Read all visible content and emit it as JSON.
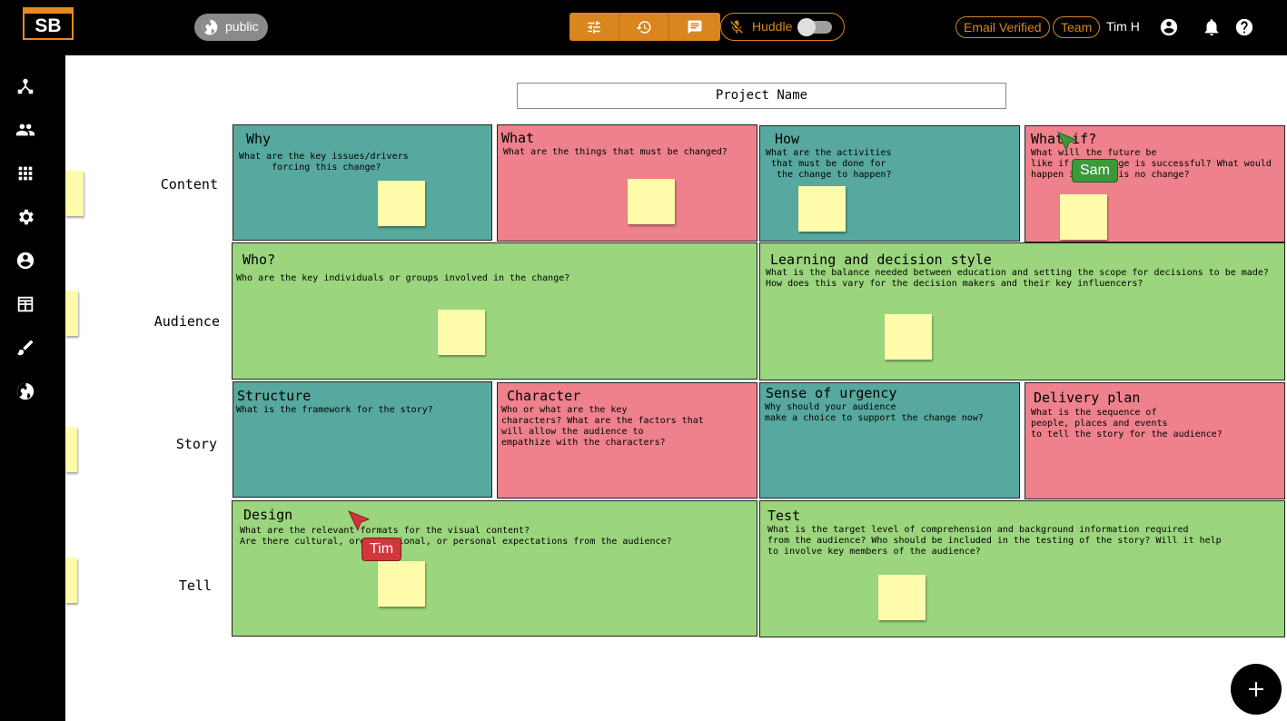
{
  "topbar": {
    "logo_text": "SB",
    "visibility_label": "public",
    "huddle_label": "Huddle",
    "email_verified_label": "Email Verified",
    "team_label": "Team",
    "user_name": "Tim H",
    "accent_color": "#d9861f"
  },
  "board": {
    "project_name": "Project Name",
    "rows": [
      "Content",
      "Audience",
      "Story",
      "Tell"
    ],
    "cells": {
      "why": {
        "title": "Why",
        "desc": "What are the key issues/drivers\n      forcing this change?"
      },
      "what": {
        "title": "What",
        "desc": "What are the things that must be changed?"
      },
      "how": {
        "title": "How",
        "desc": "What are the activities\n that must be done for\n  the change to happen?"
      },
      "what_if": {
        "title": "What if?",
        "desc": "What will the future be\nlike if the change is successful? What would\nhappen if there is no change?"
      },
      "who": {
        "title": "Who?",
        "desc": "Who are the key individuals or groups involved in the change?"
      },
      "learning": {
        "title": "Learning and decision style",
        "desc": "What is the balance needed between education and setting the scope for decisions to be made?\nHow does this vary for the decision makers and their key influencers?"
      },
      "structure": {
        "title": "Structure",
        "desc": "What is the framework for the story?"
      },
      "character": {
        "title": "Character",
        "desc": "Who or what are the key\ncharacters? What are the factors that\nwill allow the audience to\nempathize with the characters?"
      },
      "urgency": {
        "title": "Sense of urgency",
        "desc": "Why should your audience\nmake a choice to support the change now?"
      },
      "delivery": {
        "title": "Delivery plan",
        "desc": "What is the sequence of\npeople, places and events\nto tell the story for the audience?"
      },
      "design": {
        "title": "Design",
        "desc": "What are the relevant formats for the visual content?\nAre there cultural, organizational, or personal expectations from the audience?"
      },
      "test": {
        "title": "Test",
        "desc": "What is the target level of comprehension and background information required\nfrom the audience? Who should be included in the testing of the story? Will it help\nto involve key members of the audience?"
      }
    }
  },
  "cursors": [
    {
      "name": "Sam",
      "color": "#3a9a3a"
    },
    {
      "name": "Tim",
      "color": "#d0363c"
    }
  ],
  "colors": {
    "teal": "#57a89e",
    "pink": "#ee818b",
    "green": "#9bd57d",
    "sticky": "#fefcaa"
  }
}
